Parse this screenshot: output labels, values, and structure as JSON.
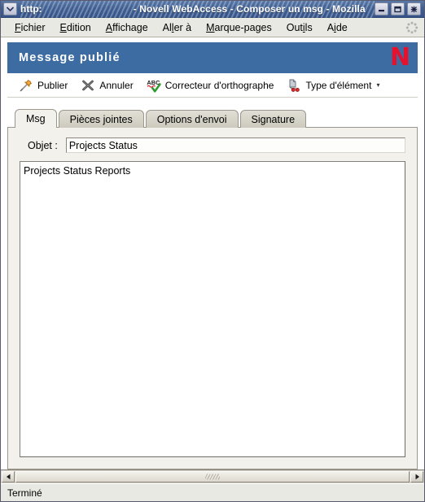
{
  "window": {
    "title_url": "http:",
    "title_suffix": "- Novell WebAccess - Composer un msg - Mozilla",
    "menu_button_icon": "chevron-down-icon",
    "controls": {
      "minimize": "–",
      "maximize": "❑",
      "close": "✖"
    }
  },
  "menubar": {
    "items": [
      {
        "pre": "F",
        "mn": "",
        "post": "",
        "full": "Fichier",
        "m_index": 0
      },
      {
        "full": "Edition",
        "m_index": 0
      },
      {
        "full": "Affichage",
        "m_index": 0
      },
      {
        "full": "Aller à",
        "m_index": 2
      },
      {
        "full": "Marque-pages",
        "m_index": 0
      },
      {
        "full": "Outils",
        "m_index": 4
      },
      {
        "full": "Aide",
        "m_index": 1
      }
    ],
    "labels": {
      "fichier": "Fichier",
      "edition": "Edition",
      "affichage": "Affichage",
      "aller_a": "Aller à",
      "marque_pages": "Marque-pages",
      "outils": "Outils",
      "aide": "Aide"
    },
    "throbber_icon": "mozilla-throbber-icon"
  },
  "banner": {
    "title": "Message publié",
    "logo_letter": "N",
    "logo_name": "novell-logo",
    "bg_color": "#3d6ca3",
    "logo_color": "#e8112d"
  },
  "toolbar": {
    "buttons": [
      {
        "label": "Publier",
        "icon": "pushpin-icon",
        "has_caret": false
      },
      {
        "label": "Annuler",
        "icon": "cancel-x-icon",
        "has_caret": false
      },
      {
        "label": "Correcteur d'orthographe",
        "icon": "spellcheck-abc-icon",
        "has_caret": false
      },
      {
        "label": "Type d'élément",
        "icon": "item-type-icon",
        "has_caret": true
      }
    ],
    "caret_glyph": "▾"
  },
  "tabs": [
    {
      "label": "Msg",
      "active": true
    },
    {
      "label": "Pièces jointes",
      "active": false
    },
    {
      "label": "Options d'envoi",
      "active": false
    },
    {
      "label": "Signature",
      "active": false
    }
  ],
  "compose": {
    "subject_label": "Objet :",
    "subject_value": "Projects Status",
    "subject_placeholder": "",
    "body_value": "Projects Status Reports",
    "body_placeholder": ""
  },
  "scrollbar": {
    "left_arrow": "◄",
    "right_arrow": "►"
  },
  "statusbar": {
    "text": "Terminé"
  }
}
